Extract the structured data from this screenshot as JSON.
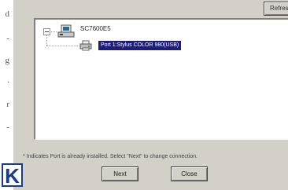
{
  "margin_chars": [
    "d",
    "-",
    "g",
    ".",
    "r",
    "-"
  ],
  "toolbar": {
    "refresh_label": "Refresh"
  },
  "tree": {
    "root_label": "SC7600E5",
    "selected_port": "Port 1:Stylus COLOR 980(USB)"
  },
  "note_text": "* Indicates Port is already installed. Select \"Next\" to change connection.",
  "logo_letter": "K",
  "buttons": {
    "next_label": "Next",
    "close_label": "Close"
  },
  "colors": {
    "dialog_bg": "#d4d0c8",
    "selection_bg": "#1c1c7a",
    "logo_blue": "#1a3a8a"
  }
}
